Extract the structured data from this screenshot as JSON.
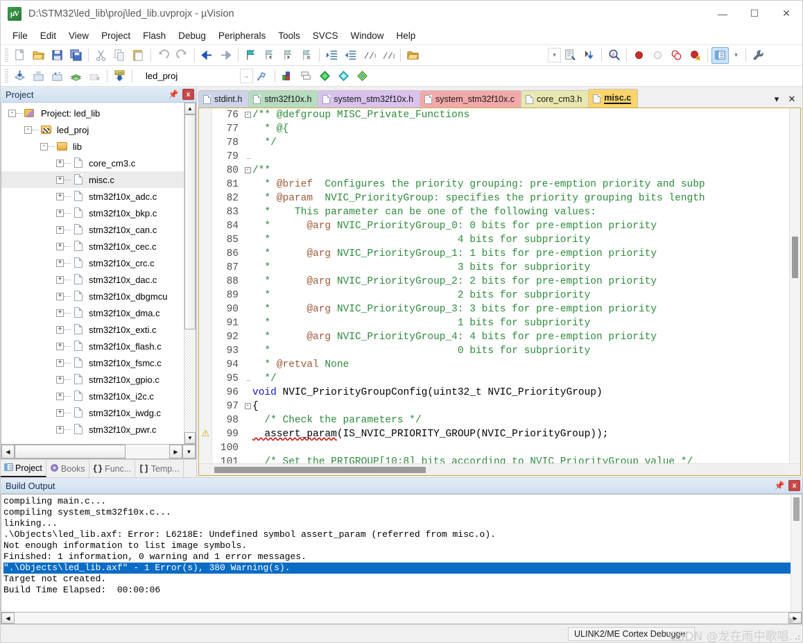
{
  "window": {
    "title": "D:\\STM32\\led_lib\\proj\\led_lib.uvprojx - µVision",
    "app_icon_label": "µV",
    "minimize": "—",
    "maximize": "☐",
    "close": "✕"
  },
  "menu": [
    "File",
    "Edit",
    "View",
    "Project",
    "Flash",
    "Debug",
    "Peripherals",
    "Tools",
    "SVCS",
    "Window",
    "Help"
  ],
  "toolbar1": [
    {
      "name": "new-file-icon",
      "glyph": "🗎"
    },
    {
      "name": "open-file-icon",
      "glyph": "📂"
    },
    {
      "name": "save-icon",
      "glyph": "💾"
    },
    {
      "name": "save-all-icon",
      "glyph": "🖫"
    },
    {
      "name": "cut-icon",
      "glyph": "✂"
    },
    {
      "name": "copy-icon",
      "glyph": "❐"
    },
    {
      "name": "paste-icon",
      "glyph": "📋"
    },
    {
      "name": "undo-icon",
      "glyph": "↶"
    },
    {
      "name": "redo-icon",
      "glyph": "↷"
    },
    {
      "name": "navigate-back-icon",
      "glyph": "←"
    },
    {
      "name": "navigate-forward-icon",
      "glyph": "→"
    },
    {
      "name": "bookmark-toggle-icon",
      "glyph": "⚑"
    },
    {
      "name": "bookmark-prev-icon",
      "glyph": "⚑"
    },
    {
      "name": "bookmark-next-icon",
      "glyph": "⚑"
    },
    {
      "name": "bookmark-clear-icon",
      "glyph": "⚑"
    },
    {
      "name": "indent-icon",
      "glyph": "≡"
    },
    {
      "name": "outdent-icon",
      "glyph": "≡"
    },
    {
      "name": "comment-icon",
      "glyph": "//"
    },
    {
      "name": "uncomment-icon",
      "glyph": "//"
    },
    {
      "name": "open-folder-icon",
      "glyph": "📁"
    }
  ],
  "toolbar1_right": [
    {
      "name": "configure-target-icon"
    },
    {
      "name": "manage-components-icon"
    },
    {
      "name": "find-in-files-icon"
    },
    {
      "name": "insert-breakpoint-icon"
    },
    {
      "name": "disable-breakpoint-icon"
    },
    {
      "name": "disable-all-breakpoints-icon"
    },
    {
      "name": "kill-all-breakpoints-icon"
    },
    {
      "name": "project-window-toggle-icon"
    },
    {
      "name": "utilities-icon"
    }
  ],
  "toolbar2": {
    "buttons": [
      {
        "name": "translate-icon"
      },
      {
        "name": "build-icon"
      },
      {
        "name": "rebuild-icon"
      },
      {
        "name": "batch-build-icon"
      },
      {
        "name": "stop-build-icon"
      },
      {
        "name": "download-icon",
        "label": "LOAD"
      }
    ],
    "target_value": "led_proj",
    "target_dropdown_glyph": "⌄",
    "after_buttons": [
      {
        "name": "target-options-icon"
      },
      {
        "name": "manage-project-items-icon"
      },
      {
        "name": "multi-project-icon"
      },
      {
        "name": "run-to-cursor-icon"
      },
      {
        "name": "pack-installer-icon"
      },
      {
        "name": "manage-run-env-icon"
      }
    ]
  },
  "project_panel": {
    "caption": "Project",
    "pin_glyph": "📌",
    "close_glyph": "x",
    "tree": [
      {
        "label": "Project: led_lib",
        "depth": 0,
        "icon": "project-icon",
        "toggle": "-",
        "selected": false
      },
      {
        "label": "led_proj",
        "depth": 1,
        "icon": "target-icon",
        "toggle": "-",
        "selected": false
      },
      {
        "label": "lib",
        "depth": 2,
        "icon": "folder-icon",
        "toggle": "-",
        "selected": false
      },
      {
        "label": "core_cm3.c",
        "depth": 3,
        "icon": "file-icon",
        "toggle": "+",
        "selected": false
      },
      {
        "label": "misc.c",
        "depth": 3,
        "icon": "file-icon",
        "toggle": "+",
        "selected": true
      },
      {
        "label": "stm32f10x_adc.c",
        "depth": 3,
        "icon": "file-icon",
        "toggle": "+",
        "selected": false
      },
      {
        "label": "stm32f10x_bkp.c",
        "depth": 3,
        "icon": "file-icon",
        "toggle": "+",
        "selected": false
      },
      {
        "label": "stm32f10x_can.c",
        "depth": 3,
        "icon": "file-icon",
        "toggle": "+",
        "selected": false
      },
      {
        "label": "stm32f10x_cec.c",
        "depth": 3,
        "icon": "file-icon",
        "toggle": "+",
        "selected": false
      },
      {
        "label": "stm32f10x_crc.c",
        "depth": 3,
        "icon": "file-icon",
        "toggle": "+",
        "selected": false
      },
      {
        "label": "stm32f10x_dac.c",
        "depth": 3,
        "icon": "file-icon",
        "toggle": "+",
        "selected": false
      },
      {
        "label": "stm32f10x_dbgmcu",
        "depth": 3,
        "icon": "file-icon",
        "toggle": "+",
        "selected": false
      },
      {
        "label": "stm32f10x_dma.c",
        "depth": 3,
        "icon": "file-icon",
        "toggle": "+",
        "selected": false
      },
      {
        "label": "stm32f10x_exti.c",
        "depth": 3,
        "icon": "file-icon",
        "toggle": "+",
        "selected": false
      },
      {
        "label": "stm32f10x_flash.c",
        "depth": 3,
        "icon": "file-icon",
        "toggle": "+",
        "selected": false
      },
      {
        "label": "stm32f10x_fsmc.c",
        "depth": 3,
        "icon": "file-icon",
        "toggle": "+",
        "selected": false
      },
      {
        "label": "stm32f10x_gpio.c",
        "depth": 3,
        "icon": "file-icon",
        "toggle": "+",
        "selected": false
      },
      {
        "label": "stm32f10x_i2c.c",
        "depth": 3,
        "icon": "file-icon",
        "toggle": "+",
        "selected": false
      },
      {
        "label": "stm32f10x_iwdg.c",
        "depth": 3,
        "icon": "file-icon",
        "toggle": "+",
        "selected": false
      },
      {
        "label": "stm32f10x_pwr.c",
        "depth": 3,
        "icon": "file-icon",
        "toggle": "+",
        "selected": false
      }
    ],
    "bottom_tabs": [
      {
        "label": "Project",
        "icon": "project-window-icon",
        "active": true
      },
      {
        "label": "Books",
        "icon": "books-icon",
        "active": false
      },
      {
        "label": "Func...",
        "icon": "functions-icon",
        "active": false
      },
      {
        "label": "Temp...",
        "icon": "templates-icon",
        "active": false
      }
    ]
  },
  "editor": {
    "tabs": [
      {
        "label": "stdint.h",
        "color": "#cdd4e8",
        "active": false
      },
      {
        "label": "stm32f10x.h",
        "color": "#b7dcc0",
        "active": false
      },
      {
        "label": "system_stm32f10x.h",
        "color": "#d9c3ee",
        "active": false
      },
      {
        "label": "system_stm32f10x.c",
        "color": "#f3a9a9",
        "active": false
      },
      {
        "label": "core_cm3.h",
        "color": "#e8e7b0",
        "active": false
      },
      {
        "label": "misc.c",
        "color": "#fbd46a",
        "active": true
      }
    ],
    "tab_menu_glyph": "▾",
    "tab_close_glyph": "✕",
    "warning_marker_line": 99,
    "warning_glyph": "⚠",
    "lines": [
      {
        "n": 76,
        "fold": "box-minus",
        "segs": [
          {
            "t": "/** @defgroup MISC_Private_Functions",
            "c": "cmt"
          }
        ]
      },
      {
        "n": 77,
        "fold": "bar",
        "segs": [
          {
            "t": "  * @{",
            "c": "cmt"
          }
        ]
      },
      {
        "n": 78,
        "fold": "bar",
        "segs": [
          {
            "t": "  */",
            "c": "cmt"
          }
        ]
      },
      {
        "n": 79,
        "fold": "bar-end",
        "segs": [
          {
            "t": "",
            "c": "cmt"
          }
        ]
      },
      {
        "n": 80,
        "fold": "box-minus",
        "segs": [
          {
            "t": "/**",
            "c": "cmt"
          }
        ]
      },
      {
        "n": 81,
        "fold": "bar",
        "segs": [
          {
            "t": "  * ",
            "c": "cmt"
          },
          {
            "t": "@brief",
            "c": "cmt-tag"
          },
          {
            "t": "  Configures the priority grouping: pre-emption priority and subp",
            "c": "cmt"
          }
        ]
      },
      {
        "n": 82,
        "fold": "bar",
        "segs": [
          {
            "t": "  * ",
            "c": "cmt"
          },
          {
            "t": "@param",
            "c": "cmt-tag"
          },
          {
            "t": "  NVIC_PriorityGroup: specifies the priority grouping bits length",
            "c": "cmt"
          }
        ]
      },
      {
        "n": 83,
        "fold": "bar",
        "segs": [
          {
            "t": "  *    This parameter can be one of the following values:",
            "c": "cmt"
          }
        ]
      },
      {
        "n": 84,
        "fold": "bar",
        "segs": [
          {
            "t": "  *      ",
            "c": "cmt"
          },
          {
            "t": "@arg",
            "c": "cmt-tag"
          },
          {
            "t": " NVIC_PriorityGroup_0: 0 bits for pre-emption priority",
            "c": "cmt"
          }
        ]
      },
      {
        "n": 85,
        "fold": "bar",
        "segs": [
          {
            "t": "  *                               4 bits for subpriority",
            "c": "cmt"
          }
        ]
      },
      {
        "n": 86,
        "fold": "bar",
        "segs": [
          {
            "t": "  *      ",
            "c": "cmt"
          },
          {
            "t": "@arg",
            "c": "cmt-tag"
          },
          {
            "t": " NVIC_PriorityGroup_1: 1 bits for pre-emption priority",
            "c": "cmt"
          }
        ]
      },
      {
        "n": 87,
        "fold": "bar",
        "segs": [
          {
            "t": "  *                               3 bits for subpriority",
            "c": "cmt"
          }
        ]
      },
      {
        "n": 88,
        "fold": "bar",
        "segs": [
          {
            "t": "  *      ",
            "c": "cmt"
          },
          {
            "t": "@arg",
            "c": "cmt-tag"
          },
          {
            "t": " NVIC_PriorityGroup_2: 2 bits for pre-emption priority",
            "c": "cmt"
          }
        ]
      },
      {
        "n": 89,
        "fold": "bar",
        "segs": [
          {
            "t": "  *                               2 bits for subpriority",
            "c": "cmt"
          }
        ]
      },
      {
        "n": 90,
        "fold": "bar",
        "segs": [
          {
            "t": "  *      ",
            "c": "cmt"
          },
          {
            "t": "@arg",
            "c": "cmt-tag"
          },
          {
            "t": " NVIC_PriorityGroup_3: 3 bits for pre-emption priority",
            "c": "cmt"
          }
        ]
      },
      {
        "n": 91,
        "fold": "bar",
        "segs": [
          {
            "t": "  *                               1 bits for subpriority",
            "c": "cmt"
          }
        ]
      },
      {
        "n": 92,
        "fold": "bar",
        "segs": [
          {
            "t": "  *      ",
            "c": "cmt"
          },
          {
            "t": "@arg",
            "c": "cmt-tag"
          },
          {
            "t": " NVIC_PriorityGroup_4: 4 bits for pre-emption priority",
            "c": "cmt"
          }
        ]
      },
      {
        "n": 93,
        "fold": "bar",
        "segs": [
          {
            "t": "  *                               0 bits for subpriority",
            "c": "cmt"
          }
        ]
      },
      {
        "n": 94,
        "fold": "bar",
        "segs": [
          {
            "t": "  * ",
            "c": "cmt"
          },
          {
            "t": "@retval",
            "c": "cmt-tag"
          },
          {
            "t": " None",
            "c": "cmt"
          }
        ]
      },
      {
        "n": 95,
        "fold": "bar-end",
        "segs": [
          {
            "t": "  */",
            "c": "cmt"
          }
        ]
      },
      {
        "n": 96,
        "fold": "none",
        "segs": [
          {
            "t": "void",
            "c": "kw"
          },
          {
            "t": " NVIC_PriorityGroupConfig(uint32_t NVIC_PriorityGroup)",
            "c": "plain"
          }
        ]
      },
      {
        "n": 97,
        "fold": "box-minus",
        "segs": [
          {
            "t": "{",
            "c": "plain"
          }
        ]
      },
      {
        "n": 98,
        "fold": "bar",
        "segs": [
          {
            "t": "  /* Check the parameters */",
            "c": "cmt"
          }
        ]
      },
      {
        "n": 99,
        "fold": "bar",
        "segs": [
          {
            "t": "  assert_param",
            "c": "plain squig"
          },
          {
            "t": "(IS_NVIC_PRIORITY_GROUP(NVIC_PriorityGroup));",
            "c": "plain"
          }
        ]
      },
      {
        "n": 100,
        "fold": "bar",
        "segs": [
          {
            "t": "",
            "c": "plain"
          }
        ]
      },
      {
        "n": 101,
        "fold": "bar",
        "segs": [
          {
            "t": "  /* Set the PRIGROUP[10:8] bits according to NVIC_PriorityGroup value */",
            "c": "cmt"
          }
        ]
      }
    ]
  },
  "build_output": {
    "caption": "Build Output",
    "pin_glyph": "📌",
    "close_glyph": "x",
    "lines": [
      {
        "text": "compiling main.c...",
        "highlight": false
      },
      {
        "text": "compiling system_stm32f10x.c...",
        "highlight": false
      },
      {
        "text": "linking...",
        "highlight": false
      },
      {
        "text": ".\\Objects\\led_lib.axf: Error: L6218E: Undefined symbol assert_param (referred from misc.o).",
        "highlight": false
      },
      {
        "text": "Not enough information to list image symbols.",
        "highlight": false
      },
      {
        "text": "Finished: 1 information, 0 warning and 1 error messages.",
        "highlight": false
      },
      {
        "text": "\".\\Objects\\led_lib.axf\" - 1 Error(s), 380 Warning(s).",
        "highlight": true
      },
      {
        "text": "Target not created.",
        "highlight": false
      },
      {
        "text": "Build Time Elapsed:  00:00:06",
        "highlight": false
      }
    ]
  },
  "statusbar": {
    "debugger": "ULINK2/ME Cortex Debugger",
    "watermark": "CSDN @龙在雨中歌唱."
  }
}
